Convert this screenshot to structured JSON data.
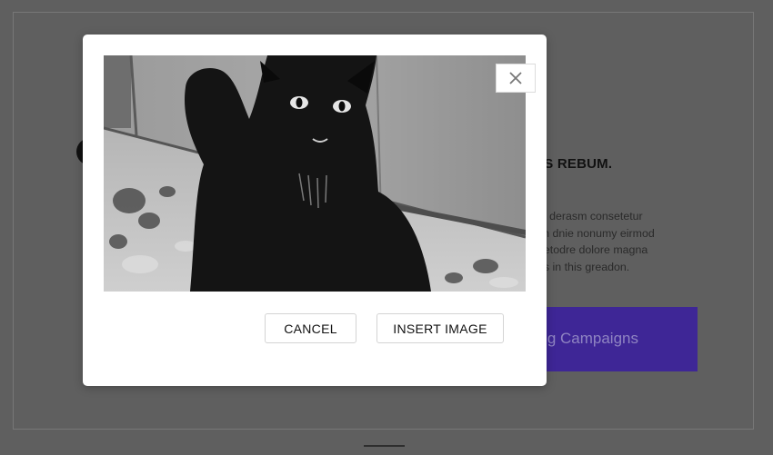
{
  "background": {
    "heading": "E MUS REBUM.",
    "paragraph_lines": [
      "it amet, derasm consetetur",
      "na diam dnie nonumy eirmod",
      "labore etodre dolore magna",
      "on lares in this greadon."
    ],
    "cta_label": "g Campaigns",
    "cta_color": "#3e2696"
  },
  "modal": {
    "image": {
      "subject": "black cat with raised paw",
      "style": "grayscale photo"
    },
    "close_icon": "close-icon",
    "cancel_label": "CANCEL",
    "insert_label": "INSERT IMAGE"
  }
}
